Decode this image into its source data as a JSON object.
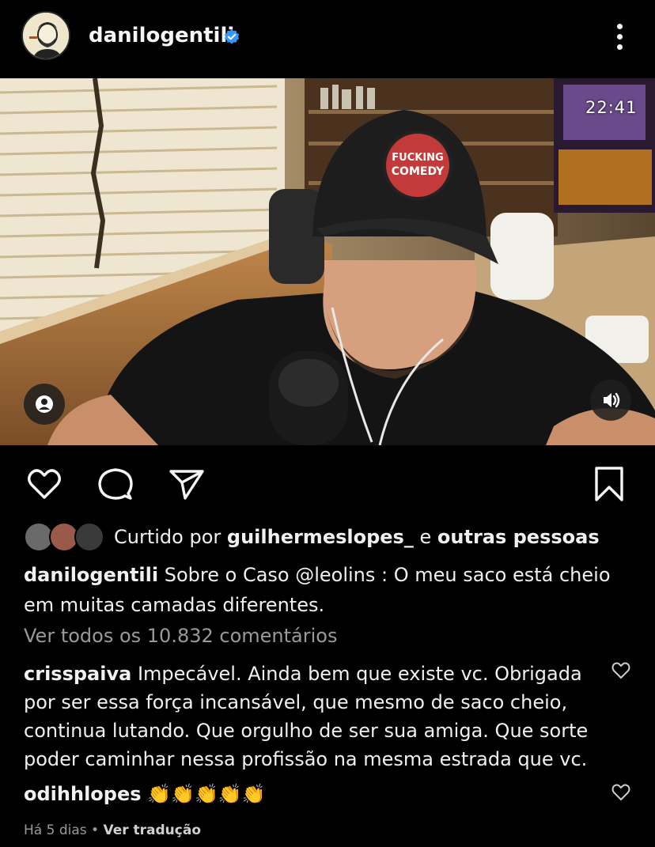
{
  "header": {
    "username": "danilogentili",
    "verified_icon": "verified-badge-icon",
    "more_icon": "more-options-icon"
  },
  "media": {
    "timestamp": "22:41",
    "tag_icon": "user-tag-icon",
    "sound_icon": "volume-icon"
  },
  "actions": {
    "like_icon": "heart-icon",
    "comment_icon": "comment-icon",
    "share_icon": "send-icon",
    "save_icon": "bookmark-icon"
  },
  "likes": {
    "prefix": "Curtido por",
    "user": "guilhermeslopes_",
    "joiner": "e",
    "others": "outras pessoas"
  },
  "caption": {
    "username": "danilogentili",
    "text": "Sobre o Caso @leolins : O meu saco está cheio em muitas camadas diferentes."
  },
  "view_all_comments": "Ver todos os 10.832 comentários",
  "comments": [
    {
      "username": "crisspaiva",
      "text": "Impecável. Ainda bem que existe vc. Obrigada por ser essa força incansável, que mesmo de saco cheio, continua lutando. Que orgulho de ser sua amiga. Que sorte poder caminhar nessa profissão na mesma estrada que vc."
    },
    {
      "username": "odihhlopes",
      "text": "👏👏👏👏👏"
    }
  ],
  "meta": {
    "time_ago": "Há 5 dias",
    "separator": "•",
    "translate": "Ver tradução"
  },
  "colors": {
    "background": "#000000",
    "text": "#f5f5f5",
    "muted": "#9a9a9a",
    "verified": "#3897f0"
  }
}
